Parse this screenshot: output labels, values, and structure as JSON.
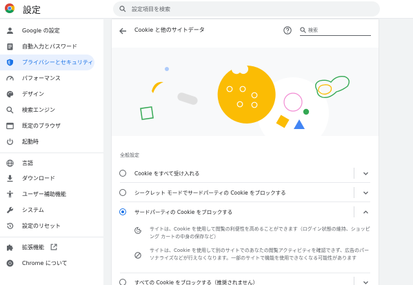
{
  "header": {
    "title": "設定",
    "search_placeholder": "設定項目を検索"
  },
  "sidebar": {
    "items": [
      {
        "label": "Google の設定",
        "icon": "person-icon"
      },
      {
        "label": "自動入力とパスワード",
        "icon": "clipboard-icon"
      },
      {
        "label": "プライバシーとセキュリティ",
        "icon": "shield-icon",
        "active": true
      },
      {
        "label": "パフォーマンス",
        "icon": "speedometer-icon"
      },
      {
        "label": "デザイン",
        "icon": "palette-icon"
      },
      {
        "label": "検索エンジン",
        "icon": "search-icon"
      },
      {
        "label": "既定のブラウザ",
        "icon": "browser-icon"
      },
      {
        "label": "起動時",
        "icon": "power-icon"
      },
      {
        "label": "言語",
        "icon": "globe-icon"
      },
      {
        "label": "ダウンロード",
        "icon": "download-icon"
      },
      {
        "label": "ユーザー補助機能",
        "icon": "accessibility-icon"
      },
      {
        "label": "システム",
        "icon": "wrench-icon"
      },
      {
        "label": "設定のリセット",
        "icon": "reset-icon"
      },
      {
        "label": "拡張機能",
        "icon": "puzzle-icon",
        "external": true
      },
      {
        "label": "Chrome について",
        "icon": "chrome-icon"
      }
    ]
  },
  "panel": {
    "title": "Cookie と他のサイトデータ",
    "search_placeholder": "検索",
    "section_label": "全般設定",
    "options": [
      {
        "label": "Cookie をすべて受け入れる",
        "checked": false,
        "expanded": false
      },
      {
        "label": "シークレット モードでサードパーティの Cookie をブロックする",
        "checked": false,
        "expanded": false
      },
      {
        "label": "サードパーティの Cookie をブロックする",
        "checked": true,
        "expanded": true
      },
      {
        "label": "すべての Cookie をブロックする（推奨されません）",
        "checked": false,
        "expanded": false
      }
    ],
    "details": [
      {
        "icon": "cookie-icon",
        "text": "サイトは、Cookie を使用して閲覧の利便性を高めることができます（ログイン状態の維持、ショッピング カートの中身の保存など）"
      },
      {
        "icon": "block-icon",
        "text": "サイトは、Cookie を使用して別のサイトでのあなたの閲覧アクティビティを確認できず、広告のパーソナライズなどが行えなくなります。一部のサイトで機能を使用できなくなる可能性があります"
      }
    ]
  },
  "colors": {
    "accent": "#1a73e8",
    "active_bg": "#e8f0fe",
    "cookie_yellow": "#fbbc04",
    "green": "#34a853",
    "pink": "#f28bd3",
    "blue": "#4285f4"
  }
}
